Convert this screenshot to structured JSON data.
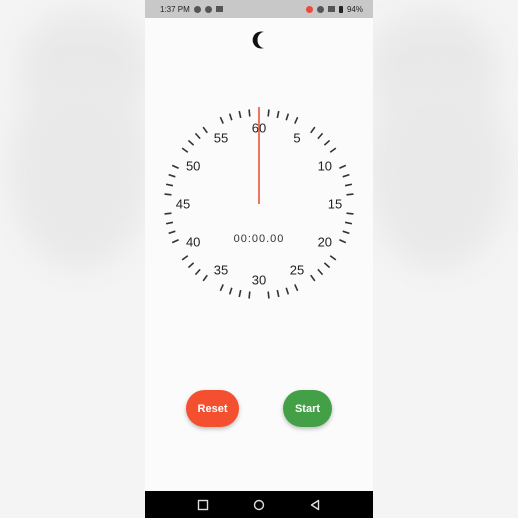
{
  "status_bar": {
    "time": "1:37 PM",
    "battery": "94%"
  },
  "theme_toggle": {
    "icon": "moon-icon"
  },
  "dial": {
    "labels": [
      "60",
      "5",
      "10",
      "15",
      "20",
      "25",
      "30",
      "35",
      "40",
      "45",
      "50",
      "55"
    ],
    "hand_color": "#e8553a"
  },
  "timer": {
    "display": "00:00.00"
  },
  "buttons": {
    "reset_label": "Reset",
    "start_label": "Start",
    "reset_color": "#f4502f",
    "start_color": "#43a047"
  },
  "nav": {
    "recents_icon": "square-icon",
    "home_icon": "circle-icon",
    "back_icon": "triangle-back-icon"
  }
}
